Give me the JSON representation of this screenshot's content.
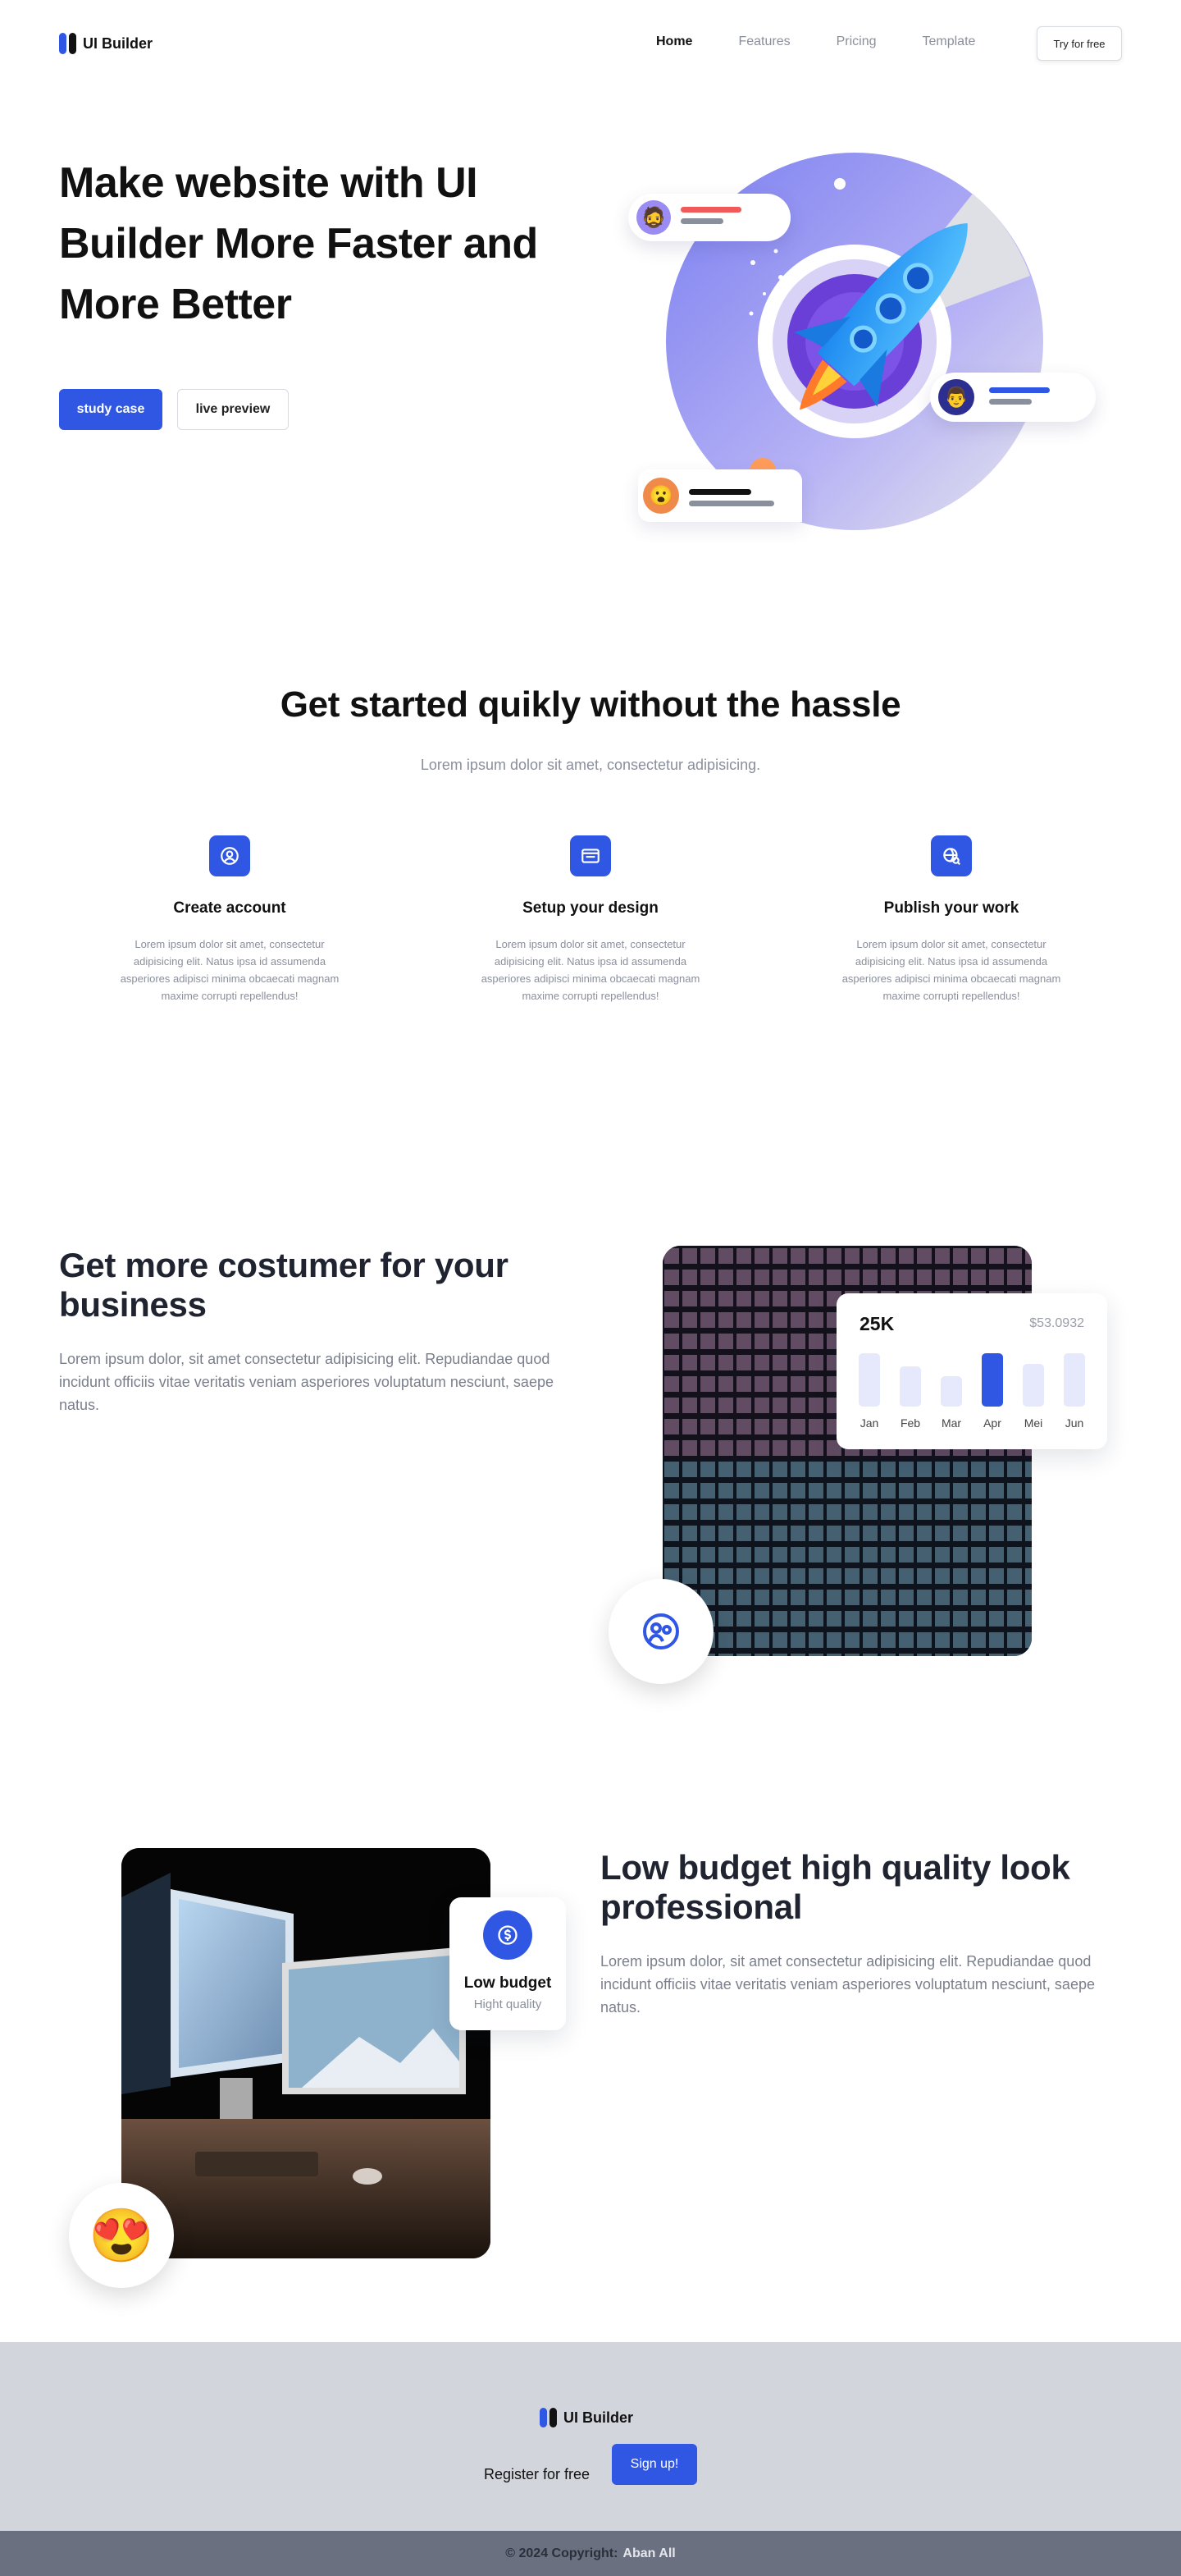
{
  "nav": {
    "brand": "UI Builder",
    "links": [
      {
        "label": "Home",
        "active": true
      },
      {
        "label": "Features",
        "active": false
      },
      {
        "label": "Pricing",
        "active": false
      },
      {
        "label": "Template",
        "active": false
      }
    ],
    "cta": "Try for free"
  },
  "hero": {
    "title_lines": [
      "Make website with UI",
      "Builder More Faster and",
      "More Better"
    ],
    "primary_btn": "study case",
    "secondary_btn": "live preview"
  },
  "steps": {
    "title": "Get started quikly without the hassle",
    "subtitle": "Lorem ipsum dolor sit amet, consectetur adipisicing.",
    "items": [
      {
        "icon": "user-circle-icon",
        "title": "Create account",
        "text": "Lorem ipsum dolor sit amet, consectetur adipisicing elit. Natus ipsa id assumenda asperiores adipisci minima obcaecati magnam maxime corrupti repellendus!"
      },
      {
        "icon": "browser-window-icon",
        "title": "Setup your design",
        "text": "Lorem ipsum dolor sit amet, consectetur adipisicing elit. Natus ipsa id assumenda asperiores adipisci minima obcaecati magnam maxime corrupti repellendus!"
      },
      {
        "icon": "globe-search-icon",
        "title": "Publish your work",
        "text": "Lorem ipsum dolor sit amet, consectetur adipisicing elit. Natus ipsa id assumenda asperiores adipisci minima obcaecati magnam maxime corrupti repellendus!"
      }
    ]
  },
  "customers": {
    "title": "Get more costumer for your business",
    "text": "Lorem ipsum dolor, sit amet consectetur adipisicing elit. Repudiandae quod incidunt officiis vitae veritatis veniam asperiores voluptatum nesciunt, saepe natus.",
    "stat_card": {
      "value": "25K",
      "amount": "$53.0932",
      "months": [
        "Jan",
        "Feb",
        "Mar",
        "Apr",
        "Mei",
        "Jun"
      ],
      "levels": [
        0.9,
        0.68,
        0.52,
        0.9,
        0.72,
        0.9
      ],
      "highlight": "Apr"
    }
  },
  "budget": {
    "title": "Low budget high quality look professional",
    "text": "Lorem ipsum dolor, sit amet consectetur adipisicing elit. Repudiandae quod incidunt officiis vitae veritatis veniam asperiores voluptatum nesciunt, saepe natus.",
    "badge_title": "Low budget",
    "badge_sub": "Hight quality"
  },
  "footer": {
    "brand": "UI Builder",
    "register_text": "Register for free",
    "signup": "Sign up!",
    "copyright": "© 2024 Copyright:",
    "author": "Aban All"
  },
  "colors": {
    "accent": "#2f57e4",
    "footer_bg": "#d3d5dd",
    "footer_bottom": "#6b7080"
  }
}
